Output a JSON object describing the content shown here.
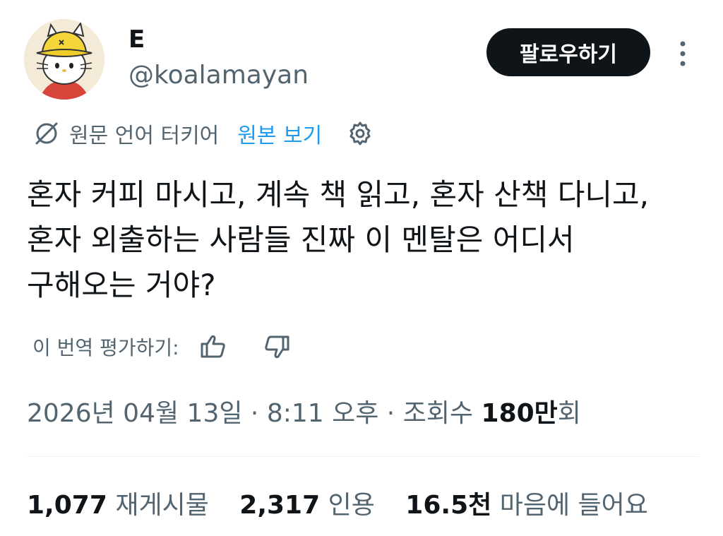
{
  "author": {
    "display_name": "E",
    "handle": "@koalamayan"
  },
  "follow_button_label": "팔로우하기",
  "translation": {
    "label": "원문 언어 터키어",
    "show_original": "원본 보기"
  },
  "tweet_lines": [
    "혼자 커피 마시고, 계속 책 읽고, 혼자 산책 다니고,",
    "혼자 외출하는 사람들 진짜 이 멘탈은 어디서",
    "구해오는 거야?"
  ],
  "rate_translation_label": "이 번역 평가하기:",
  "meta": {
    "date": "2026년 04월 13일",
    "sep1": " · ",
    "time": "8:11 오후",
    "sep2": " · ",
    "views_prefix": "조회수 ",
    "views_count": "180만",
    "views_suffix": "회"
  },
  "stats": {
    "reposts_count": "1,077",
    "reposts_label": "재게시물",
    "quotes_count": "2,317",
    "quotes_label": "인용",
    "likes_count": "16.5천",
    "likes_label": "마음에 들어요"
  },
  "colors": {
    "text": "#0f1419",
    "secondary": "#536471",
    "link": "#1d9bf0",
    "button_bg": "#0f1419"
  },
  "icons": [
    "more-vertical-icon",
    "globe-off-icon",
    "settings-gear-icon",
    "thumbs-up-icon",
    "thumbs-down-icon"
  ]
}
